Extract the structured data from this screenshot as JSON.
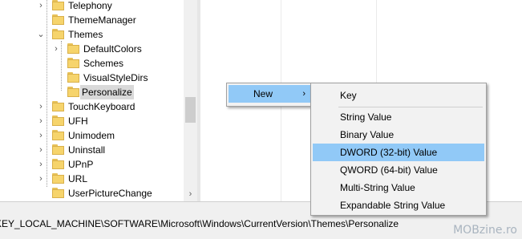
{
  "tree": {
    "items": [
      {
        "label": "Telephony"
      },
      {
        "label": "ThemeManager"
      },
      {
        "label": "Themes"
      },
      {
        "label": "DefaultColors"
      },
      {
        "label": "Schemes"
      },
      {
        "label": "VisualStyleDirs"
      },
      {
        "label": "Personalize"
      },
      {
        "label": "TouchKeyboard"
      },
      {
        "label": "UFH"
      },
      {
        "label": "Unimodem"
      },
      {
        "label": "Uninstall"
      },
      {
        "label": "UPnP"
      },
      {
        "label": "URL"
      },
      {
        "label": "UserPictureChange"
      }
    ]
  },
  "context_menu": {
    "new_label": "New",
    "new_arrow": "›"
  },
  "submenu": {
    "items": [
      {
        "label": "Key"
      },
      {
        "label": "String Value"
      },
      {
        "label": "Binary Value"
      },
      {
        "label": "DWORD (32-bit) Value"
      },
      {
        "label": "QWORD (64-bit) Value"
      },
      {
        "label": "Multi-String Value"
      },
      {
        "label": "Expandable String Value"
      }
    ]
  },
  "status_bar": {
    "path": "KEY_LOCAL_MACHINE\\SOFTWARE\\Microsoft\\Windows\\CurrentVersion\\Themes\\Personalize"
  },
  "watermark": "MOBzine.ro",
  "icons": {
    "expand": "›",
    "collapse": "⌄",
    "scroll_right": "›"
  },
  "colors": {
    "highlight": "#91c9f7",
    "selected_tree_item": "#d9d9d9",
    "folder": "#f6d46c"
  }
}
